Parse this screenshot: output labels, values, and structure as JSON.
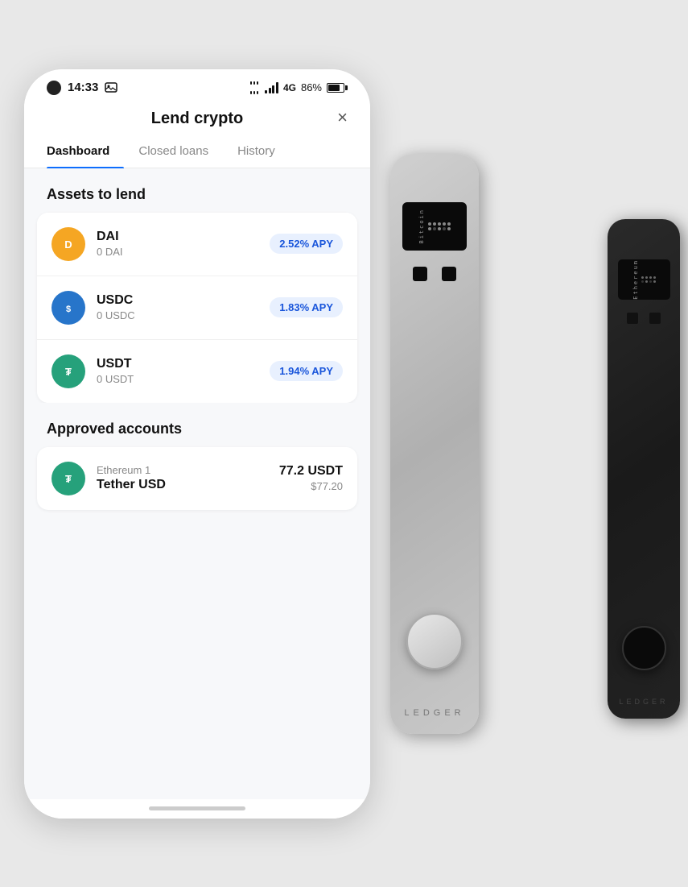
{
  "status": {
    "time": "14:33",
    "battery": "86%"
  },
  "header": {
    "title": "Lend crypto",
    "close_label": "×"
  },
  "tabs": [
    {
      "id": "dashboard",
      "label": "Dashboard",
      "active": true
    },
    {
      "id": "closed-loans",
      "label": "Closed loans",
      "active": false
    },
    {
      "id": "history",
      "label": "History",
      "active": false
    }
  ],
  "assets_section": {
    "title": "Assets to lend",
    "items": [
      {
        "symbol": "DAI",
        "name": "DAI",
        "balance": "0 DAI",
        "apy": "2.52% APY",
        "icon_label": "D"
      },
      {
        "symbol": "USDC",
        "name": "USDC",
        "balance": "0 USDC",
        "apy": "1.83% APY",
        "icon_label": "$"
      },
      {
        "symbol": "USDT",
        "name": "USDT",
        "balance": "0 USDT",
        "apy": "1.94% APY",
        "icon_label": "T"
      }
    ]
  },
  "approved_section": {
    "title": "Approved accounts",
    "items": [
      {
        "account_label": "Ethereum 1",
        "name": "Tether USD",
        "amount": "77.2 USDT",
        "usd_value": "$77.20",
        "icon_label": "T"
      }
    ]
  },
  "ledger": {
    "label": "LEDGER"
  }
}
